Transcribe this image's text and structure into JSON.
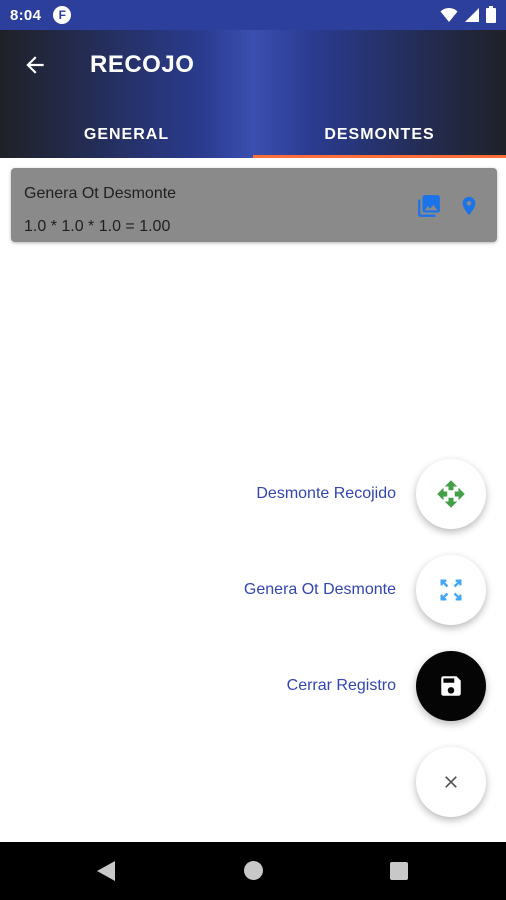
{
  "status_bar": {
    "time": "8:04",
    "app_icon": "F",
    "icons": [
      "wifi-icon",
      "signal-icon",
      "battery-icon"
    ]
  },
  "app_bar": {
    "title": "RECOJO",
    "back_icon": "arrow-back-icon",
    "tabs": [
      {
        "label": "GENERAL",
        "selected": false
      },
      {
        "label": "DESMONTES",
        "selected": true
      }
    ],
    "indicator_color": "#ff6d3b"
  },
  "card": {
    "title": "Genera Ot Desmonte",
    "formula": "1.0 * 1.0 * 1.0 = 1.00",
    "icons": [
      "photo-library-icon",
      "location-pin-icon"
    ],
    "icon_color": "#1a73e8"
  },
  "fab_menu": {
    "items": [
      {
        "label": "Desmonte Recojido",
        "icon": "move-arrows-icon",
        "icon_color": "#43a047"
      },
      {
        "label": "Genera Ot Desmonte",
        "icon": "expand-icon",
        "icon_color": "#42a5f5"
      },
      {
        "label": "Cerrar Registro",
        "icon": "save-icon",
        "icon_color": "#ffffff"
      }
    ],
    "close_icon": "close-icon"
  },
  "nav_bar": {
    "buttons": [
      "nav-back-icon",
      "nav-home-icon",
      "nav-recents-icon"
    ]
  }
}
